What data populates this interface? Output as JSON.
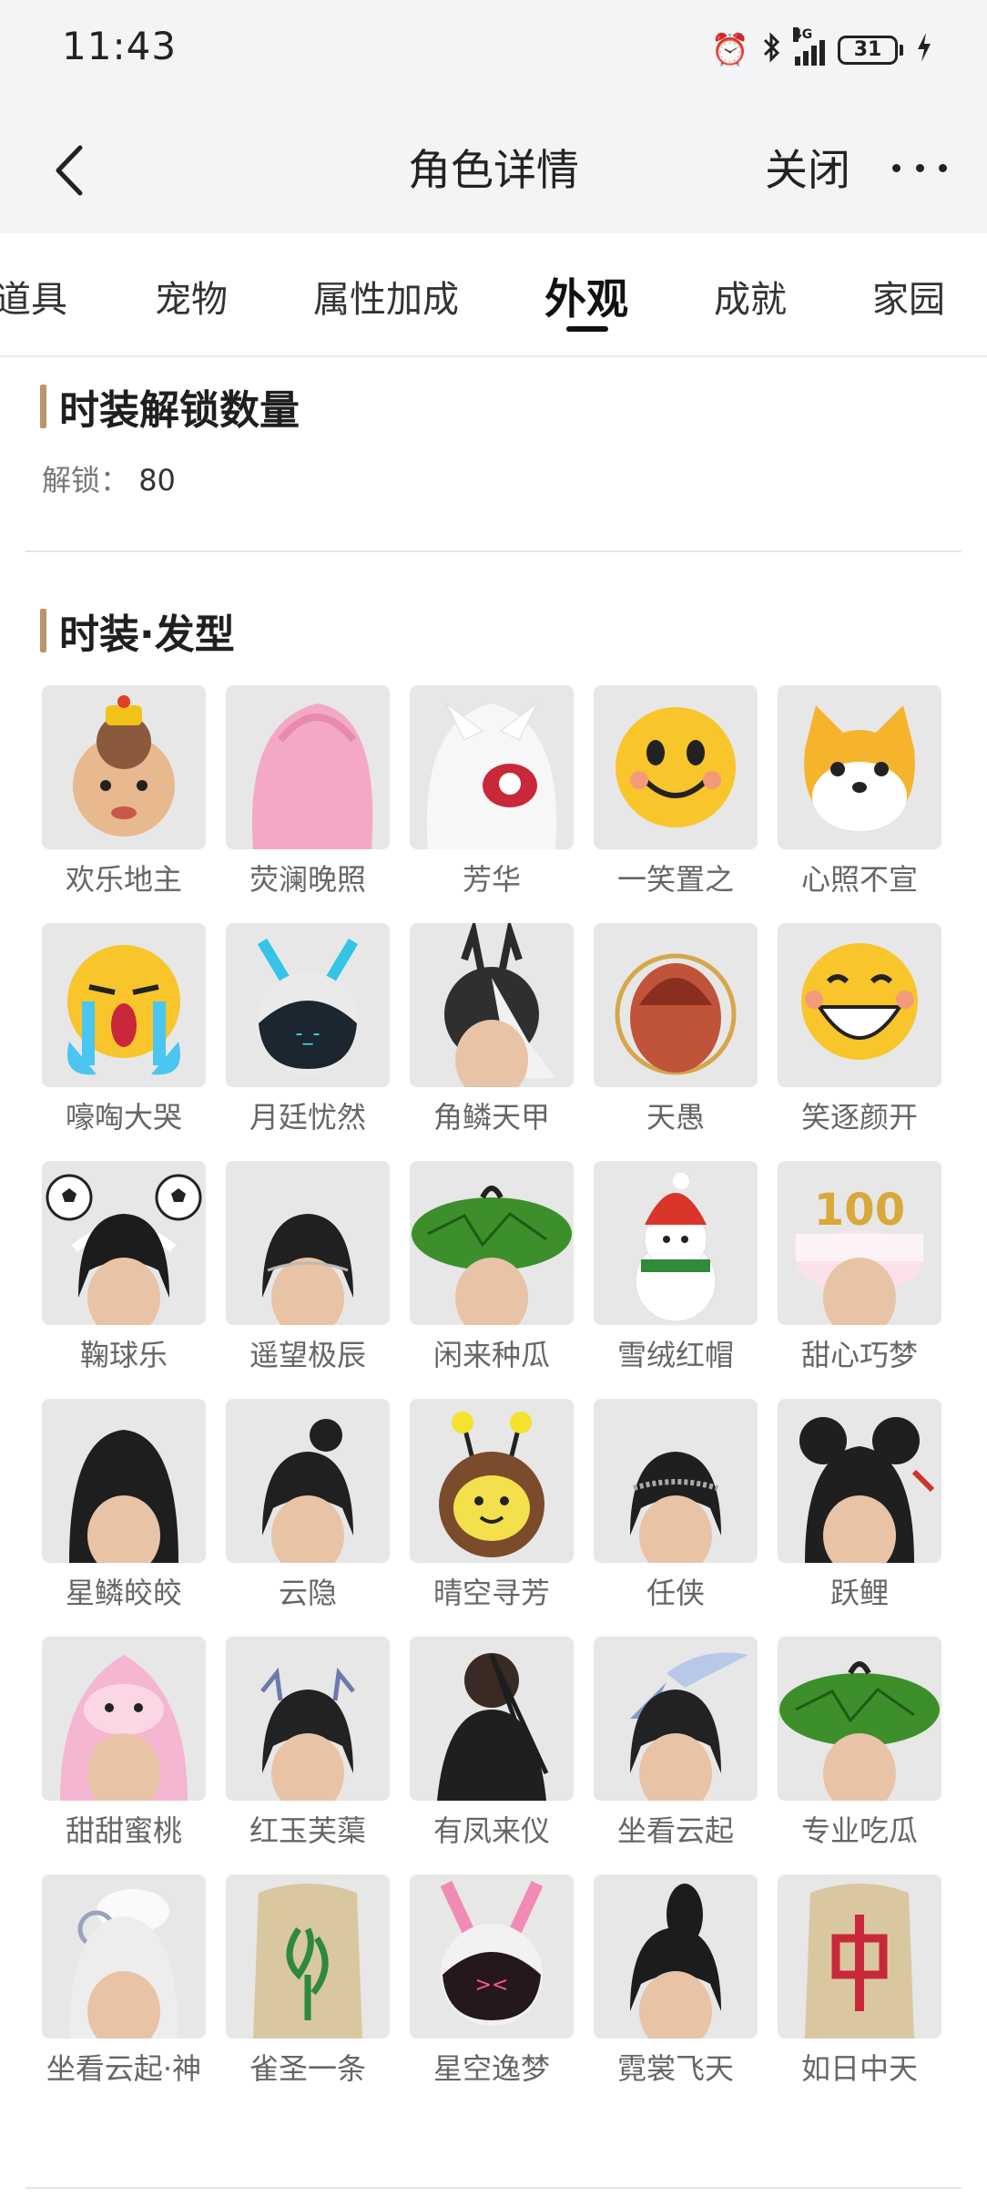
{
  "status_bar": {
    "time": "11:43",
    "network": "4G",
    "battery": "31",
    "icons": [
      "alarm-icon",
      "bluetooth-icon",
      "signal-icon",
      "battery-icon",
      "charging-icon"
    ]
  },
  "nav": {
    "title": "角色详情",
    "close_label": "关闭"
  },
  "tabs": [
    {
      "label": "道具",
      "active": false
    },
    {
      "label": "宠物",
      "active": false
    },
    {
      "label": "属性加成",
      "active": false
    },
    {
      "label": "外观",
      "active": true
    },
    {
      "label": "成就",
      "active": false
    },
    {
      "label": "家园",
      "active": false
    }
  ],
  "unlock_section": {
    "title": "时装解锁数量",
    "label": "解锁：",
    "value": "80"
  },
  "fashion_section": {
    "title": "时装·发型",
    "items": [
      {
        "name": "欢乐地主",
        "icon": "landlord-hat-icon"
      },
      {
        "name": "荧澜晚照",
        "icon": "pink-hair-icon"
      },
      {
        "name": "芳华",
        "icon": "lion-mask-icon"
      },
      {
        "name": "一笑置之",
        "icon": "smile-emoji-icon"
      },
      {
        "name": "心照不宣",
        "icon": "shiba-head-icon"
      },
      {
        "name": "嚎啕大哭",
        "icon": "crying-emoji-icon"
      },
      {
        "name": "月廷忧然",
        "icon": "visor-helmet-icon"
      },
      {
        "name": "角鳞天甲",
        "icon": "horned-helmet-icon"
      },
      {
        "name": "天愚",
        "icon": "hairy-head-icon"
      },
      {
        "name": "笑逐颜开",
        "icon": "grin-emoji-icon"
      },
      {
        "name": "鞠球乐",
        "icon": "football-headband-icon"
      },
      {
        "name": "遥望极辰",
        "icon": "black-hair-icon"
      },
      {
        "name": "闲来种瓜",
        "icon": "melon-hat-icon"
      },
      {
        "name": "雪绒红帽",
        "icon": "snowman-hat-icon"
      },
      {
        "name": "甜心巧梦",
        "icon": "cake-hat-icon"
      },
      {
        "name": "星鳞皎皎",
        "icon": "long-hair-icon"
      },
      {
        "name": "云隐",
        "icon": "topknot-hair-icon"
      },
      {
        "name": "晴空寻芳",
        "icon": "bee-hat-icon"
      },
      {
        "name": "任侠",
        "icon": "headband-hair-icon"
      },
      {
        "name": "跃鲤",
        "icon": "bun-hair-icon"
      },
      {
        "name": "甜甜蜜桃",
        "icon": "peach-hood-icon"
      },
      {
        "name": "红玉芙蕖",
        "icon": "lotus-hair-icon"
      },
      {
        "name": "有凤来仪",
        "icon": "phoenix-hair-icon"
      },
      {
        "name": "坐看云起",
        "icon": "feather-hair-icon"
      },
      {
        "name": "专业吃瓜",
        "icon": "melon-hat-icon"
      },
      {
        "name": "坐看云起·神",
        "icon": "white-hair-icon"
      },
      {
        "name": "雀圣一条",
        "icon": "mahjong-bag-icon"
      },
      {
        "name": "星空逸梦",
        "icon": "bunny-visor-icon"
      },
      {
        "name": "霓裳飞天",
        "icon": "high-bun-icon"
      },
      {
        "name": "如日中天",
        "icon": "mahjong-zhong-bag-icon"
      }
    ]
  },
  "colors": {
    "accent_bar": "#b8966a",
    "header_bg": "#f3f4f6",
    "thumb_bg": "#e7e7e7"
  }
}
